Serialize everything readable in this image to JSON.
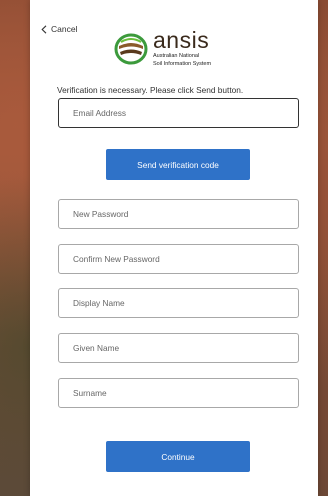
{
  "cancel": {
    "label": "Cancel"
  },
  "logo": {
    "name": "ansis",
    "subtitle_line1": "Australian National",
    "subtitle_line2": "Soil Information System"
  },
  "notice": "Verification is necessary. Please click Send button.",
  "fields": {
    "email": {
      "placeholder": "Email Address",
      "value": ""
    },
    "new_password": {
      "placeholder": "New Password",
      "value": ""
    },
    "confirm_password": {
      "placeholder": "Confirm New Password",
      "value": ""
    },
    "display_name": {
      "placeholder": "Display Name",
      "value": ""
    },
    "given_name": {
      "placeholder": "Given Name",
      "value": ""
    },
    "surname": {
      "placeholder": "Surname",
      "value": ""
    }
  },
  "buttons": {
    "send_code": "Send verification code",
    "continue": "Continue"
  },
  "colors": {
    "primary": "#2f72c8",
    "logo_green": "#3c9a3c",
    "logo_brown": "#8a5a2b"
  },
  "icons": [
    "chevron-left-icon",
    "ansis-logo-icon"
  ]
}
